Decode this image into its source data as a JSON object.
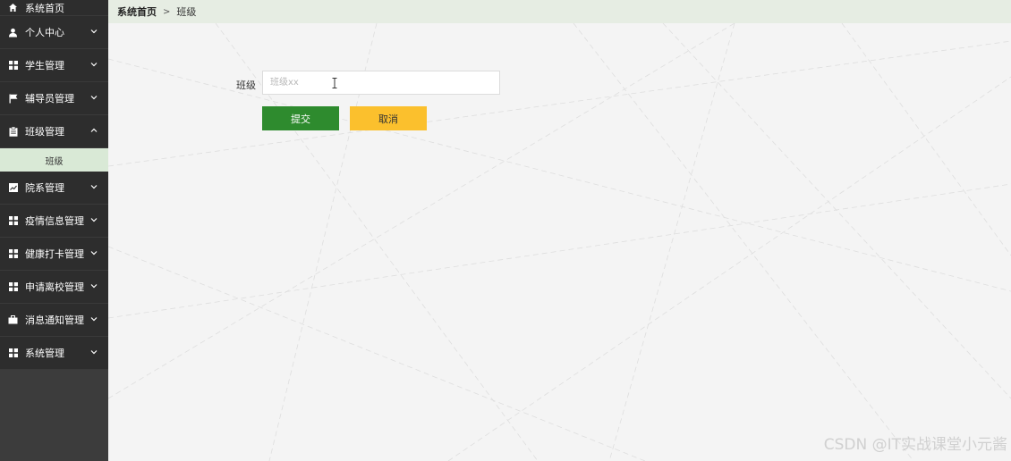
{
  "sidebar": {
    "items": [
      {
        "label": "系统首页",
        "icon": "home-icon"
      },
      {
        "label": "个人中心",
        "icon": "user-icon"
      },
      {
        "label": "学生管理",
        "icon": "grid-icon"
      },
      {
        "label": "辅导员管理",
        "icon": "flag-icon"
      },
      {
        "label": "班级管理",
        "icon": "clipboard-icon",
        "expanded": true,
        "sub": [
          "班级"
        ]
      },
      {
        "label": "院系管理",
        "icon": "chart-icon"
      },
      {
        "label": "疫情信息管理",
        "icon": "grid-icon"
      },
      {
        "label": "健康打卡管理",
        "icon": "grid-icon"
      },
      {
        "label": "申请离校管理",
        "icon": "grid-icon"
      },
      {
        "label": "消息通知管理",
        "icon": "briefcase-icon"
      },
      {
        "label": "系统管理",
        "icon": "grid-icon"
      }
    ]
  },
  "breadcrumb": {
    "home": "系统首页",
    "separator": ">",
    "current": "班级"
  },
  "form": {
    "label": "班级",
    "placeholder": "班级xx",
    "value": "",
    "submit_label": "提交",
    "cancel_label": "取消"
  },
  "watermark": "CSDN @IT实战课堂小元酱",
  "colors": {
    "sidebar_bg": "#2d2d2d",
    "active_sub_bg": "#d9e9d6",
    "submit": "#2e8b2e",
    "cancel": "#fbc02d"
  }
}
